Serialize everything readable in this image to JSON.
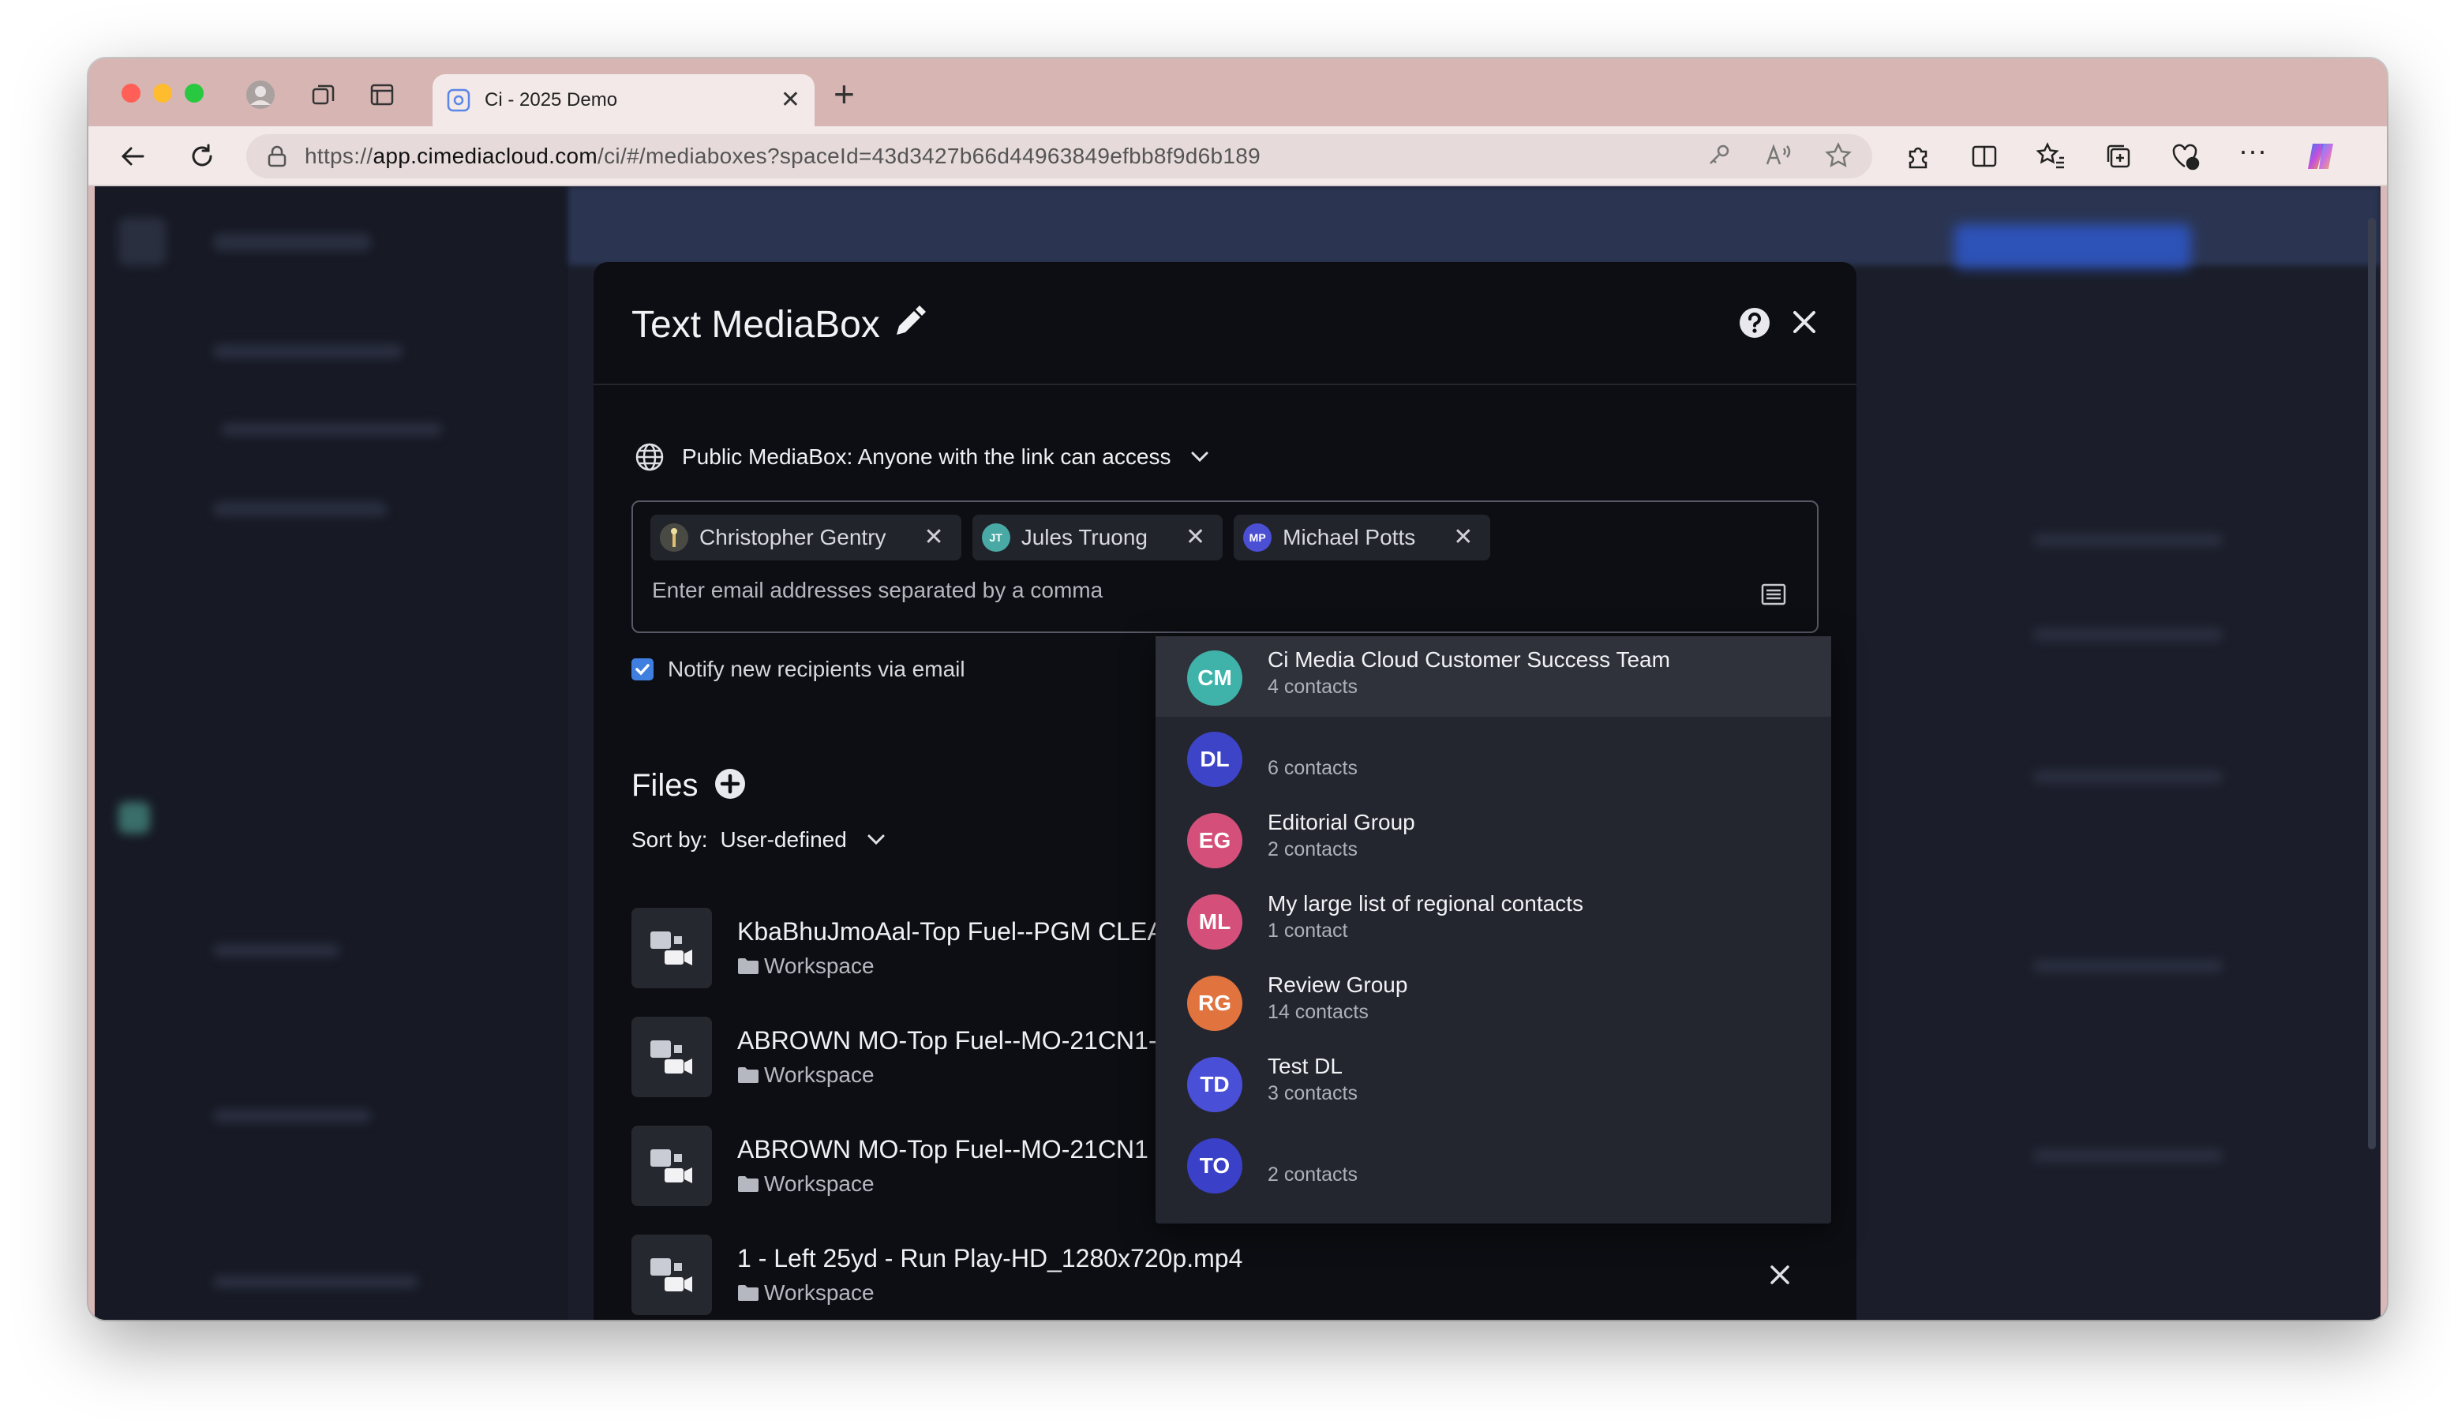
{
  "browser": {
    "tab_title": "Ci - 2025 Demo",
    "url_prefix": "https://",
    "url_host": "app.cimediacloud.com",
    "url_path": "/ci/#/mediaboxes?spaceId=43d3427b66d44963849efbb8f9d6b189"
  },
  "modal": {
    "title": "Text MediaBox",
    "access_label": "Public MediaBox: Anyone with the link can access",
    "recipients": [
      {
        "name": "Christopher Gentry",
        "initials": "",
        "color": "#3a3d46"
      },
      {
        "name": "Jules Truong",
        "initials": "JT",
        "color": "#49a9a4"
      },
      {
        "name": "Michael Potts",
        "initials": "MP",
        "color": "#4b4fd3"
      }
    ],
    "email_placeholder": "Enter email addresses separated by a comma",
    "notify_label": "Notify new recipients via email",
    "files_title": "Files",
    "sort_label": "Sort by:",
    "sort_value": "User-defined",
    "files": [
      {
        "name": "KbaBhuJmoAal-Top Fuel--PGM CLEA",
        "folder": "Workspace"
      },
      {
        "name": "ABROWN MO-Top Fuel--MO-21CN1-",
        "folder": "Workspace"
      },
      {
        "name": "ABROWN MO-Top Fuel--MO-21CN1",
        "folder": "Workspace"
      },
      {
        "name": "1 - Left 25yd - Run Play-HD_1280x720p.mp4",
        "folder": "Workspace"
      }
    ]
  },
  "dropdown": {
    "items": [
      {
        "initials": "CM",
        "name": "Ci Media Cloud Customer Success Team",
        "count": "4 contacts",
        "color": "#3fb3aa"
      },
      {
        "initials": "DL",
        "name": "",
        "count": "6 contacts",
        "color": "#3d44c8"
      },
      {
        "initials": "EG",
        "name": "Editorial Group",
        "count": "2 contacts",
        "color": "#d4507a"
      },
      {
        "initials": "ML",
        "name": "My large list of regional contacts",
        "count": "1 contact",
        "color": "#d4507a"
      },
      {
        "initials": "RG",
        "name": "Review Group",
        "count": "14 contacts",
        "color": "#e0733e"
      },
      {
        "initials": "TD",
        "name": "Test DL",
        "count": "3 contacts",
        "color": "#4a4fd8"
      },
      {
        "initials": "TO",
        "name": "",
        "count": "2 contacts",
        "color": "#3a40c8"
      }
    ]
  },
  "colors": {
    "accent_blue": "#3e7fe0",
    "modal_bg": "#0d0e13",
    "dropdown_bg": "#24262f"
  }
}
